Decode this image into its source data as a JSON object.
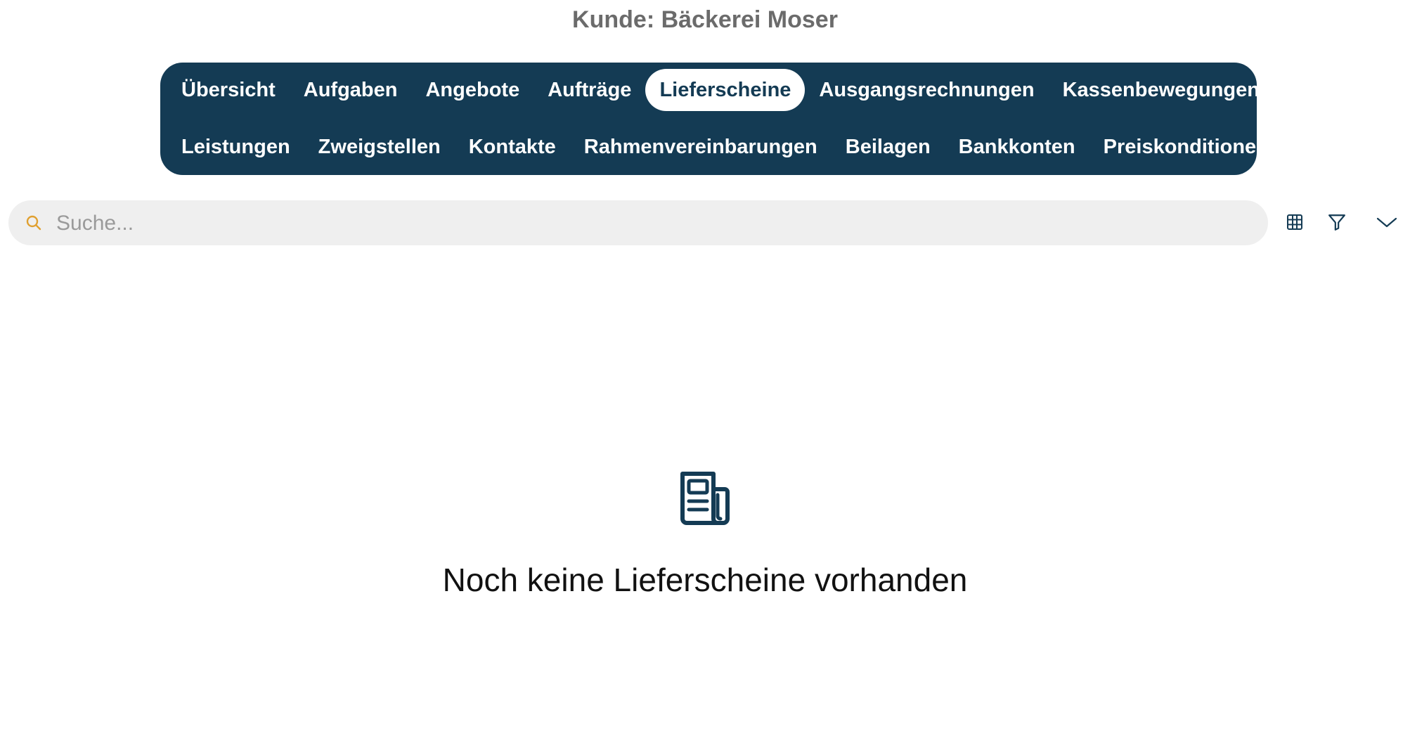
{
  "header": {
    "title": "Kunde: Bäckerei Moser"
  },
  "tabs": {
    "row1": [
      {
        "label": "Übersicht",
        "active": false
      },
      {
        "label": "Aufgaben",
        "active": false
      },
      {
        "label": "Angebote",
        "active": false
      },
      {
        "label": "Aufträge",
        "active": false
      },
      {
        "label": "Lieferscheine",
        "active": true
      },
      {
        "label": "Ausgangsrechnungen",
        "active": false
      },
      {
        "label": "Kassenbewegungen",
        "active": false
      }
    ],
    "row2": [
      {
        "label": "Leistungen",
        "active": false
      },
      {
        "label": "Zweigstellen",
        "active": false
      },
      {
        "label": "Kontakte",
        "active": false
      },
      {
        "label": "Rahmenvereinbarungen",
        "active": false
      },
      {
        "label": "Beilagen",
        "active": false
      },
      {
        "label": "Bankkonten",
        "active": false
      },
      {
        "label": "Preiskonditionen",
        "active": false
      }
    ]
  },
  "search": {
    "placeholder": "Suche...",
    "value": "",
    "icon": "search-icon"
  },
  "toolbar": {
    "icons": [
      "table-grid-icon",
      "filter-icon",
      "chevron-down-icon"
    ]
  },
  "empty_state": {
    "icon": "newspaper-icon",
    "message": "Noch keine Lieferscheine vorhanden"
  },
  "colors": {
    "primary": "#143b54",
    "search_icon": "#e0a030",
    "title": "#6b6b6b",
    "search_bg": "#efefef"
  }
}
